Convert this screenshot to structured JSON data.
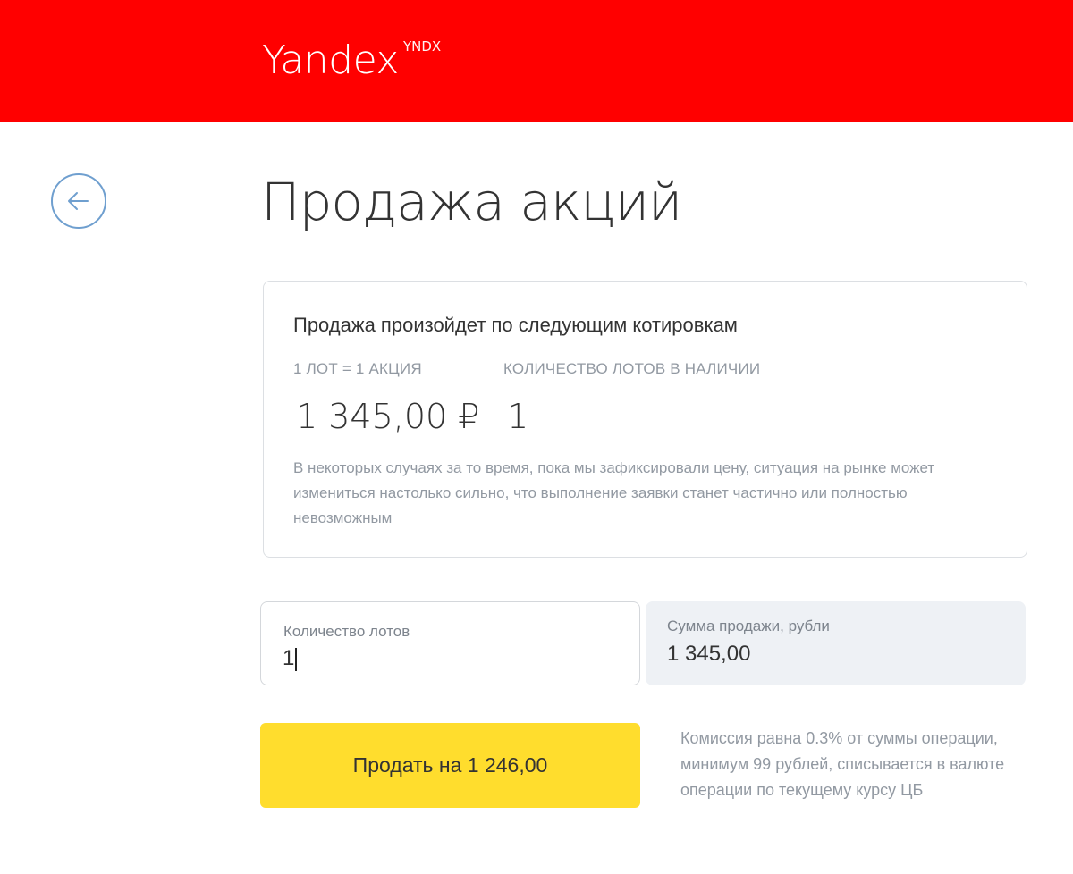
{
  "header": {
    "brand": "Yandex",
    "ticker": "YNDX",
    "brand_color": "#ff0000"
  },
  "back_button": {
    "icon": "arrow-left-icon",
    "color": "#6f9fcf"
  },
  "page": {
    "title": "Продажа акций"
  },
  "quote": {
    "heading": "Продажа произойдет по следующим котировкам",
    "lot_label": "1 ЛОТ = 1 АКЦИЯ",
    "available_label": "КОЛИЧЕСТВО ЛОТОВ В НАЛИЧИИ",
    "price": "1 345,00 ₽",
    "available_lots": "1",
    "note": "В некоторых случаях за то время, пока мы зафиксировали цену, ситуация на рынке может измениться настолько сильно, что выполнение заявки станет частично или полностью невозможным"
  },
  "form": {
    "lots_label": "Количество лотов",
    "lots_value": "1",
    "sum_label": "Сумма продажи, рубли",
    "sum_value": "1 345,00"
  },
  "sell_button": {
    "label": "Продать на 1 246,00",
    "color": "#ffdd2d"
  },
  "commission_note": "Комиссия равна 0.3% от суммы операции, минимум 99 рублей, списывается в валюте операции по текущему курсу ЦБ"
}
